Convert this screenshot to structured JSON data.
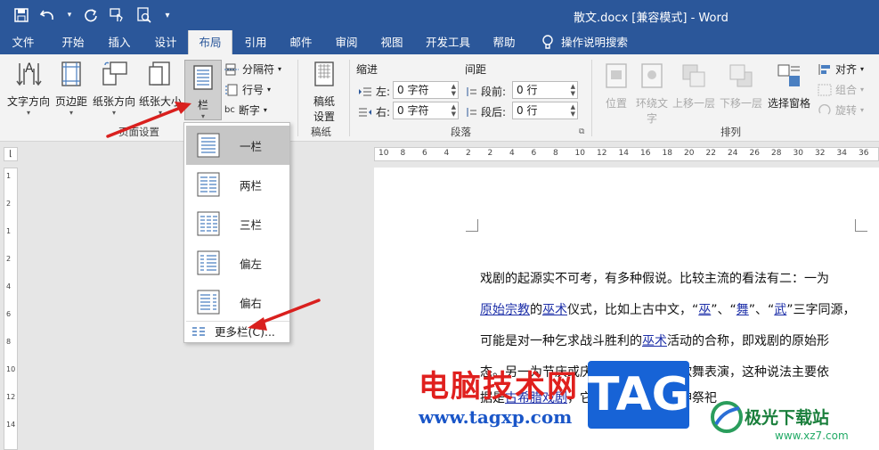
{
  "window": {
    "title": "散文.docx [兼容模式] - Word"
  },
  "qat": {
    "more": "▾"
  },
  "tabs": [
    "文件",
    "开始",
    "插入",
    "设计",
    "布局",
    "引用",
    "邮件",
    "审阅",
    "视图",
    "开发工具",
    "帮助",
    "操作说明搜索"
  ],
  "ribbon": {
    "page_setup": {
      "text_direction": "文字方向",
      "margins": "页边距",
      "orientation": "纸张方向",
      "size": "纸张大小",
      "columns": "栏",
      "breaks": "分隔符",
      "line_numbers": "行号",
      "hyphenation": "断字",
      "group_label": "页面设置"
    },
    "manuscript": {
      "button": "稿纸\n设置",
      "button_l1": "稿纸",
      "button_l2": "设置",
      "group_label": "稿纸"
    },
    "paragraph": {
      "indent_label": "缩进",
      "spacing_label": "间距",
      "left_label": "左:",
      "right_label": "右:",
      "before_label": "段前:",
      "after_label": "段后:",
      "left_value": "0 字符",
      "right_value": "0 字符",
      "before_value": "0 行",
      "after_value": "0 行",
      "group_label": "段落"
    },
    "arrange": {
      "position": "位置",
      "wrap_text": "环绕文字",
      "wrap_l1": "环绕文",
      "wrap_l2": "字",
      "bring_forward": "上移一层",
      "send_backward": "下移一层",
      "selection_pane": "选择窗格",
      "align": "对齐",
      "group": "组合",
      "rotate": "旋转",
      "group_label": "排列"
    }
  },
  "columns_menu": {
    "items": [
      "一栏",
      "两栏",
      "三栏",
      "偏左",
      "偏右"
    ],
    "selected": "一栏",
    "more": "更多栏(C)..."
  },
  "ruler": {
    "h_ticks": [
      "10",
      "8",
      "6",
      "4",
      "2",
      "2",
      "4",
      "6",
      "8",
      "10",
      "12",
      "14",
      "16",
      "18",
      "20",
      "22",
      "24",
      "26",
      "28",
      "30",
      "32",
      "34",
      "36"
    ],
    "v_ticks": [
      "1",
      "2",
      "1",
      "2",
      "4",
      "6",
      "8",
      "10",
      "12",
      "14"
    ]
  },
  "document": {
    "line1": "戏剧的起源实不可考，有多种假说。比较主流的看法有二：一为",
    "line2_parts": [
      "原始宗教",
      "的",
      "巫术",
      "仪式，比如上古中文，“",
      "巫",
      "”、“",
      "舞",
      "”、“",
      "武",
      "”三字同源，"
    ],
    "line3_parts": [
      "可能是对一种乞求战斗胜利的",
      "巫术",
      "活动的合称，即戏剧的原始形"
    ],
    "line4": "态。另一为节庆或庆祝丰收时的即兴歌舞表演，这种说法主要依",
    "line5_parts": [
      "据是",
      "古希腊戏剧",
      "，它被认为起源于酒神祭祀"
    ]
  },
  "watermarks": {
    "brand_cn": "电脑技术网",
    "brand_url": "www.tagxp.com",
    "tag": "TAG",
    "site_cn": "极光下载站",
    "site_url": "www.xz7.com"
  },
  "colors": {
    "word_blue": "#2b579a",
    "arrow_red": "#d9201e"
  }
}
